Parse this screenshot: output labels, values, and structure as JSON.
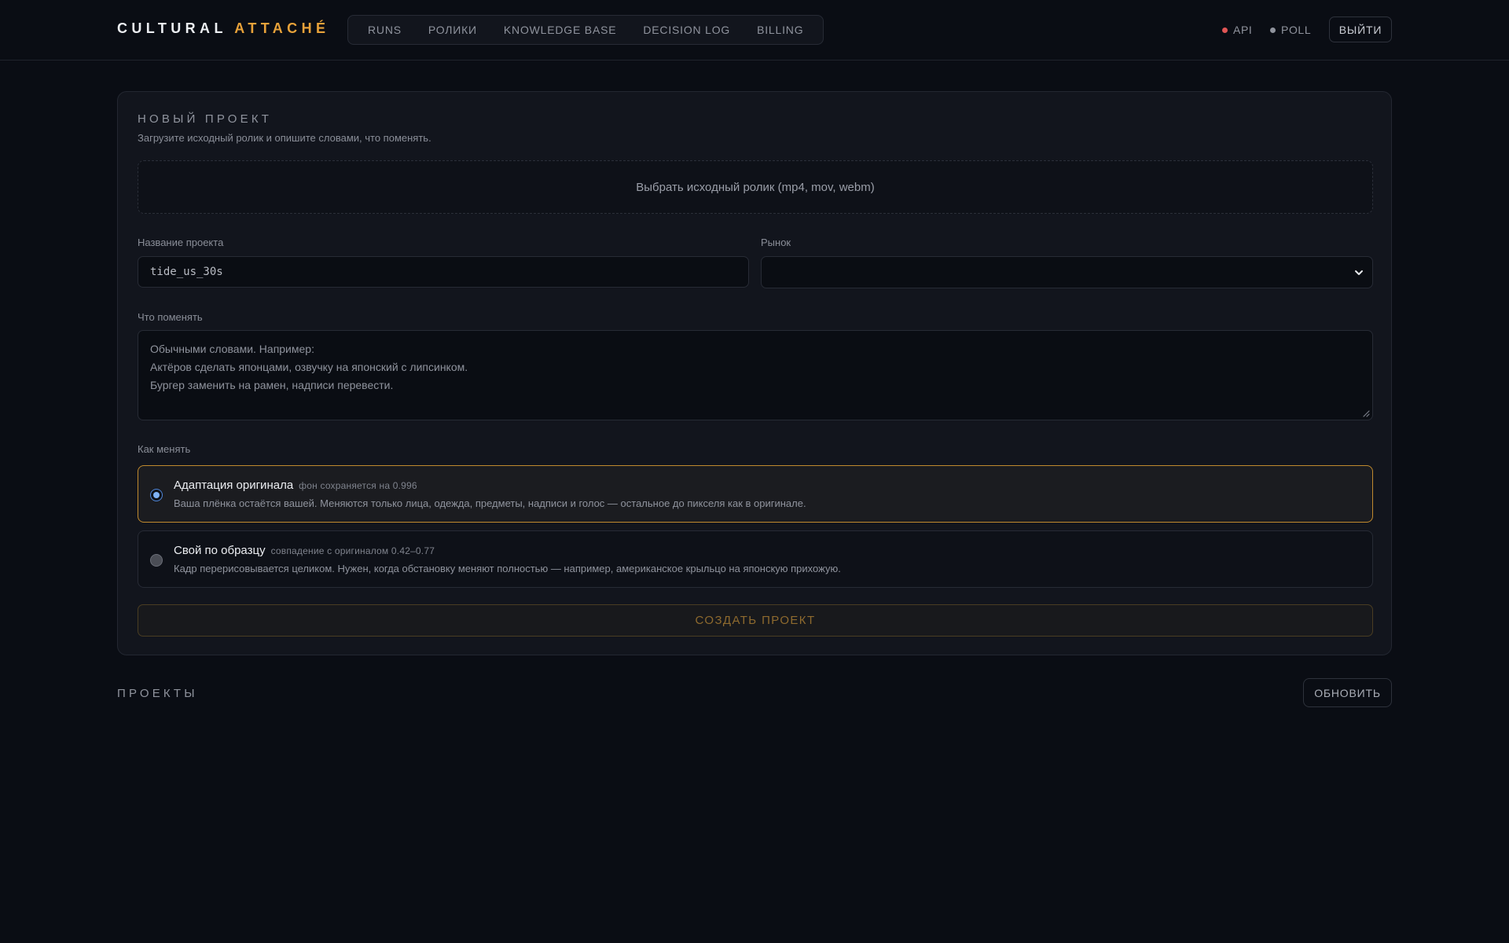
{
  "brand": {
    "name_part1": "CULTURAL",
    "name_part2": "ATTACHÉ",
    "accent_color": "#e8a23a"
  },
  "nav": {
    "items": [
      {
        "label": "RUNS"
      },
      {
        "label": "РОЛИКИ"
      },
      {
        "label": "KNOWLEDGE BASE"
      },
      {
        "label": "DECISION LOG"
      },
      {
        "label": "BILLING"
      }
    ]
  },
  "status": {
    "api": {
      "label": "API",
      "color": "#e05555"
    },
    "poll": {
      "label": "POLL",
      "color": "#8f939d"
    }
  },
  "header": {
    "logout_label": "ВЫЙТИ"
  },
  "new_project": {
    "title": "НОВЫЙ ПРОЕКТ",
    "subtitle": "Загрузите исходный ролик и опишите словами, что поменять.",
    "upload_label": "Выбрать исходный ролик (mp4, mov, webm)",
    "name_label": "Название проекта",
    "name_value": "tide_us_30s",
    "market_label": "Рынок",
    "market_value": "",
    "changes_label": "Что поменять",
    "changes_placeholder": [
      "Обычными словами. Например:",
      "Актёров сделать японцами, озвучку на японский с липсинком.",
      "Бургер заменить на рамен, надписи перевести."
    ],
    "mode_label": "Как менять",
    "modes": [
      {
        "title": "Адаптация оригинала",
        "badge": "фон сохраняется на 0.996",
        "description": "Ваша плёнка остаётся вашей. Меняются только лица, одежда, предметы, надписи и голос — остальное до пикселя как в оригинале.",
        "selected": true
      },
      {
        "title": "Свой по образцу",
        "badge": "совпадение с оригиналом 0.42–0.77",
        "description": "Кадр перерисовывается целиком. Нужен, когда обстановку меняют полностью — например, американское крыльцо на японскую прихожую.",
        "selected": false
      }
    ],
    "create_label": "СОЗДАТЬ ПРОЕКТ"
  },
  "projects": {
    "title": "ПРОЕКТЫ",
    "refresh_label": "ОБНОВИТЬ"
  },
  "icons": {
    "select_chevron": "chevron-down-icon",
    "textarea_grip": "resize-grip-icon"
  }
}
